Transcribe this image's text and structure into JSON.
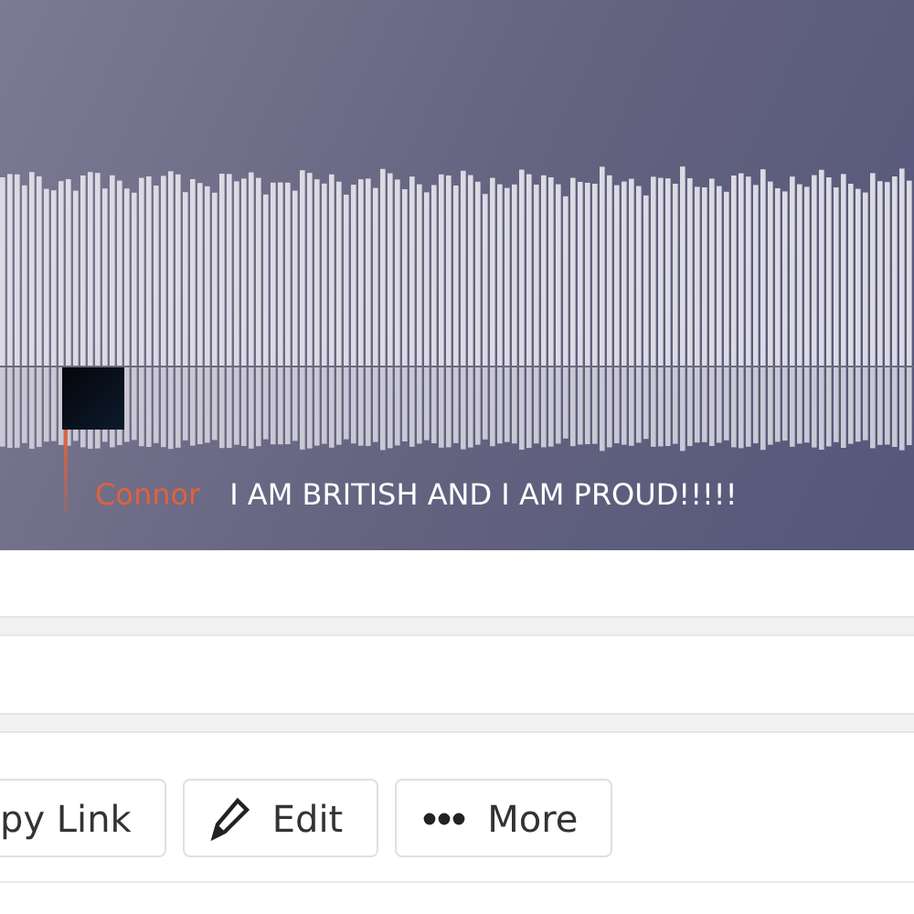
{
  "player": {
    "comment": {
      "author": "Connor",
      "text": "I AM BRITISH AND I AM PROUD!!!!!"
    }
  },
  "actions": [
    {
      "kind": "link",
      "label": "py Link"
    },
    {
      "kind": "edit",
      "label": "Edit"
    },
    {
      "kind": "more",
      "label": "More"
    }
  ]
}
